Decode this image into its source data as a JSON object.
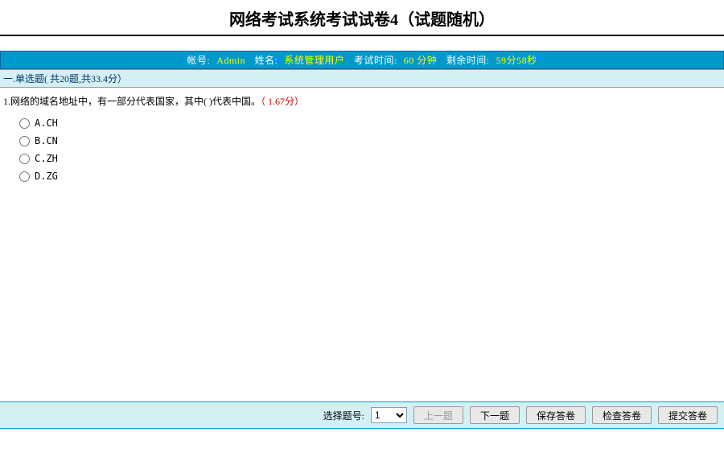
{
  "header": {
    "title": "网络考试系统考试试卷4（试题随机）"
  },
  "infoBar": {
    "accountLabel": "帐号:",
    "accountValue": "Admin",
    "nameLabel": "姓名:",
    "nameValue": "系统管理用户",
    "examTimeLabel": "考试时间:",
    "examTimeValue": "60 分钟",
    "remainingLabel": "剩余时间:",
    "remainingValue": "59分58秒"
  },
  "section": {
    "title": "一.单选题( 共20题,共33.4分）"
  },
  "question": {
    "number": "1.",
    "text": "网络的域名地址中，有一部分代表国家，其中( )代表中国。",
    "pointsText": "（ 1.67分）",
    "options": [
      {
        "label": "A.CH"
      },
      {
        "label": "B.CN"
      },
      {
        "label": "C.ZH"
      },
      {
        "label": "D.ZG"
      }
    ]
  },
  "footer": {
    "selectLabel": "选择题号:",
    "selectValue": "1",
    "prevButton": "上一题",
    "nextButton": "下一题",
    "saveButton": "保存答卷",
    "checkButton": "检查答卷",
    "submitButton": "提交答卷"
  }
}
